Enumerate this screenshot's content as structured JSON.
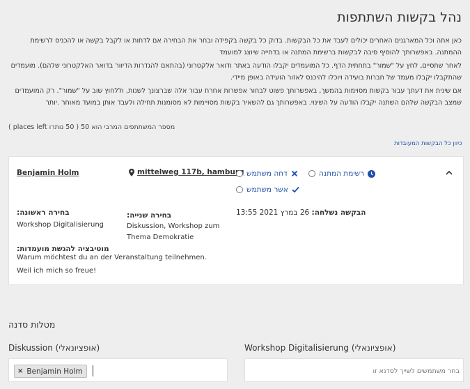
{
  "page": {
    "title": "נהל בקשות השתתפות",
    "intro": [
      "כאן אתה וכל המארגנים האחרים יכולים לעבד את כל הבקשות. בדוק כל בקשה בקפידה ובחר את הבחירה אם לדחות או לקבל בקשה או להכניס לרשימת ההמתנה. באפשרותך להוסיף סיבה לבקשות ברשימת המתנה או בדחייה שיוצג למועמד",
      "לאחר שתסיים, לחץ על \"שמור\" בתחתית הדף. כל המועמדים יקבלו הודעה באתר ודואר אלקטרוני (בהתאם להגדרות הדיוור בדואר האלקטרוני שלהם). מועמדים שהתקבלו יקבלו מעמד של חברות בועידה ויוכלו להיכנס לאזור הועידה באופן מיידי.",
      "אם שינית את דעתך עבור בקשות מסוימות בהמשך, באפשרותך פשוט לבחור אפשרות אחרת עבור אלה שברצונך לשנות, וללחוץ שוב על \"שמור\". רק המועמדים שמצב הבקשה שלהם השתנה יקבלו הודעה על השינוי. באפשרותך גם להשאיר בקשות מסויימות לא מסומנות תחילה ולעבד אותן במועד מאוחר .יותר"
    ],
    "places_text": "מספר המשתתפים המרבי הוא 50 ( 50 נותרו places left )",
    "sort_link": "כיוון כל הבקשות המעובדות"
  },
  "application": {
    "name": "Benjamin Holm",
    "address": "mittelweg 117b, hamburg",
    "statuses": {
      "waitlist": "רשימת המתנה",
      "reject": "דחה משתמש",
      "accept": "אשר משתמש"
    },
    "first_choice_label": "בחירה ראשונה:",
    "first_choice_value": "Workshop Digitalisierung",
    "second_choice_label": "בחירה שנייה:",
    "second_choice_value": "Diskussion, Workshop zum Thema Demokratie",
    "submitted_label": "הבקשה נשלחה:",
    "submitted_value": "26 במרץ 2021 13:55",
    "motivation_label": "מוטיבציה להגשת מועמדות:",
    "motivation_line1": "Warum möchtest du an der Veranstaltung teilnehmen.",
    "motivation_line2": "Weil ich mich so freue!"
  },
  "workshops": {
    "title": "מטלות סדנה",
    "diskussion_label": "Diskussion (אופציונאלי)",
    "diskussion_chip": "Benjamin Holm",
    "workshop_label": "Workshop Digitalisierung (אופציונאלי)",
    "workshop_placeholder": "בחר משתמשים לשייך לסדנא זו"
  },
  "colors": {
    "accent": "#1f4fa8",
    "background": "#eeeeee",
    "card": "#ffffff"
  }
}
